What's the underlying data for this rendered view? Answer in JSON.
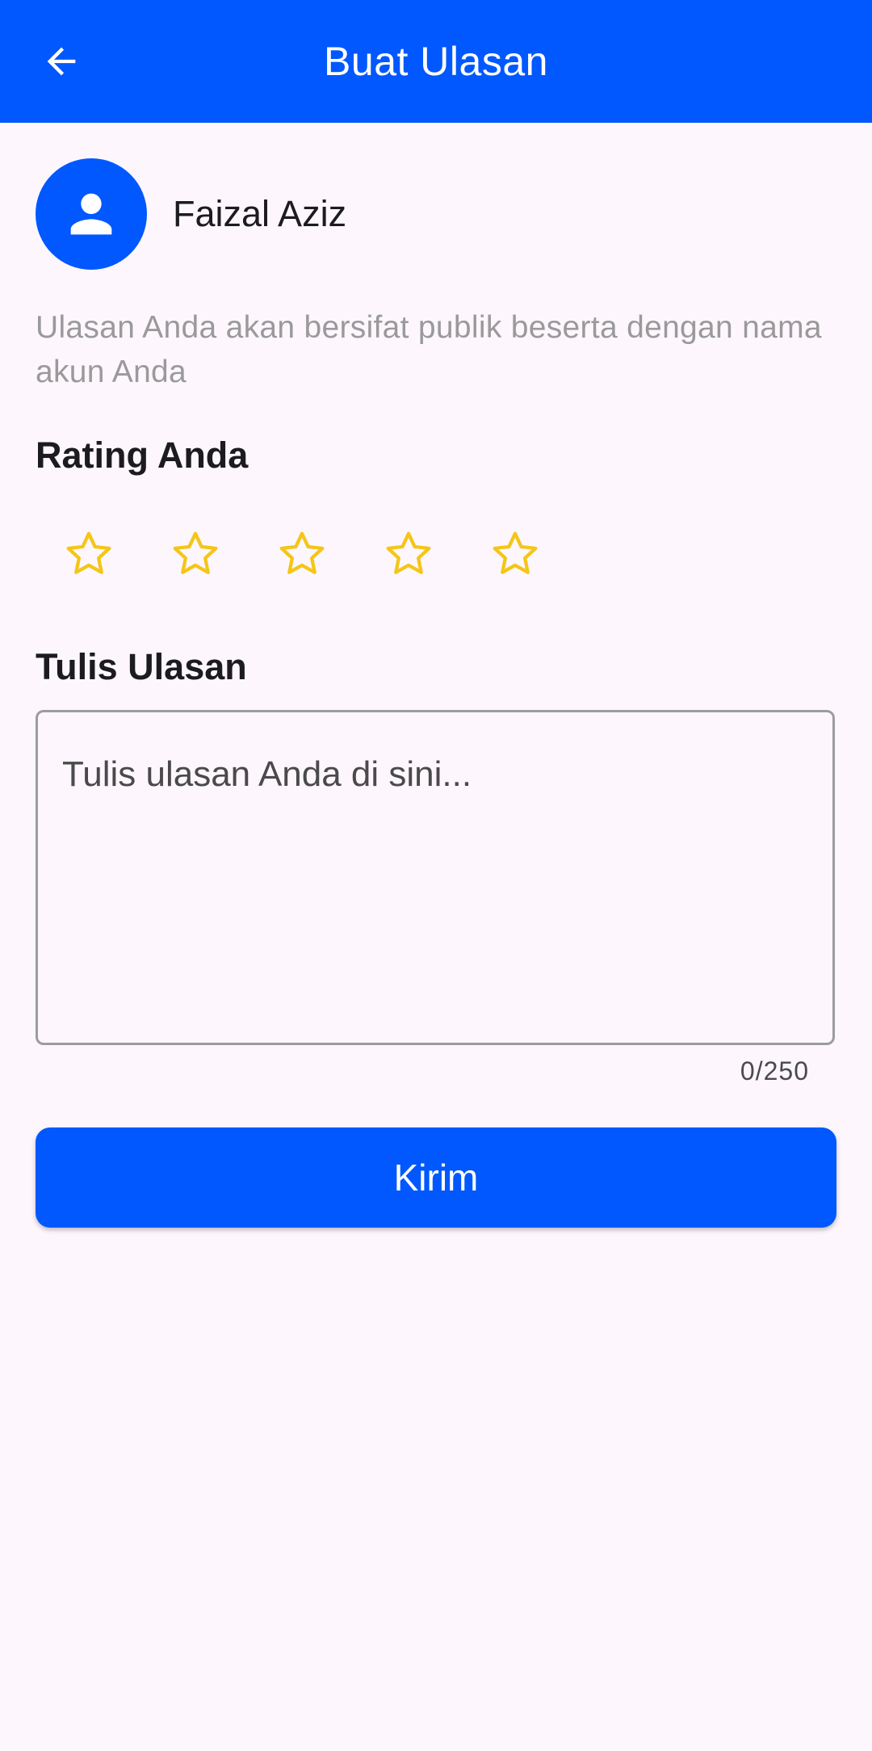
{
  "appbar": {
    "title": "Buat Ulasan",
    "back_icon": "arrow-left-icon",
    "background": "#0058fe"
  },
  "user": {
    "name": "Faizal Aziz",
    "avatar_icon": "person-icon"
  },
  "notice": "Ulasan Anda akan bersifat publik beserta dengan nama akun Anda",
  "rating": {
    "title": "Rating Anda",
    "max": 5,
    "value": 0,
    "star_icon": "star-outline-icon",
    "star_color": "#f5c518"
  },
  "review": {
    "title": "Tulis Ulasan",
    "placeholder": "Tulis ulasan Anda di sini...",
    "value": "",
    "counter": "0/250"
  },
  "submit": {
    "label": "Kirim"
  }
}
